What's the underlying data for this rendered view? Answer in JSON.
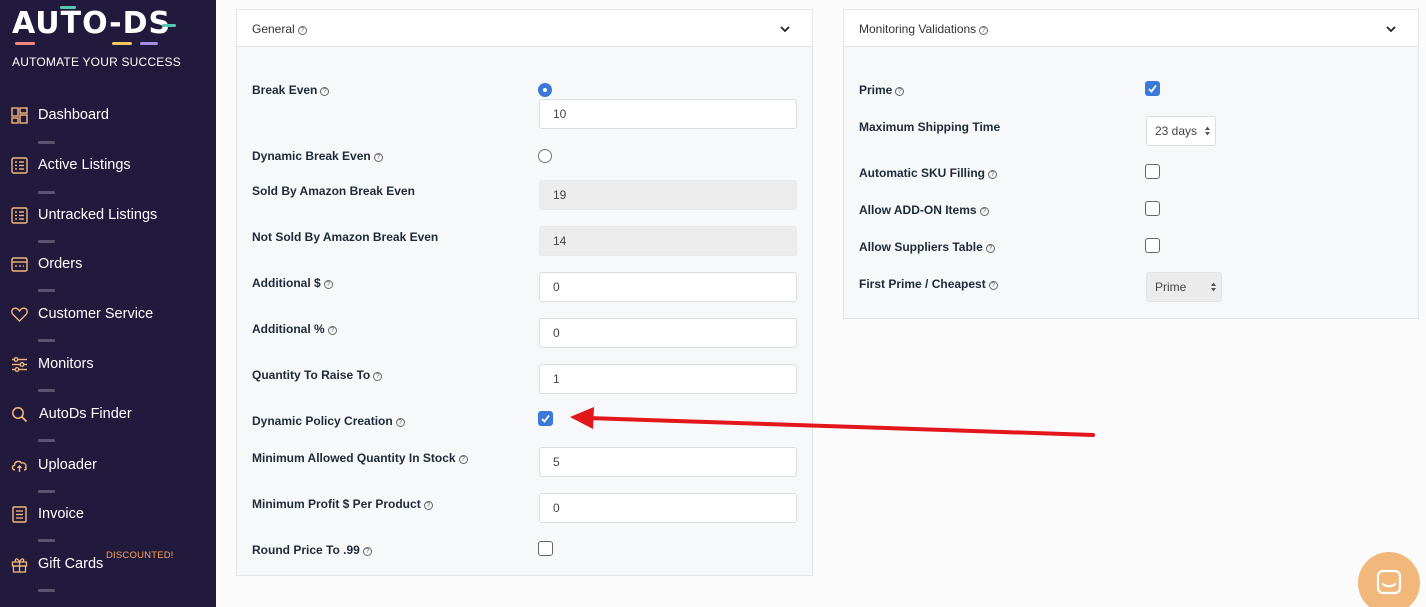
{
  "brand": {
    "logo_text": "AUTO-DS",
    "tagline": "AUTOMATE YOUR SUCCESS"
  },
  "sidebar": {
    "items": [
      {
        "label": "Dashboard",
        "icon": "dashboard-icon"
      },
      {
        "label": "Active Listings",
        "icon": "list-icon"
      },
      {
        "label": "Untracked Listings",
        "icon": "list-icon"
      },
      {
        "label": "Orders",
        "icon": "orders-icon"
      },
      {
        "label": "Customer Service",
        "icon": "heart-icon"
      },
      {
        "label": "Monitors",
        "icon": "sliders-icon"
      },
      {
        "label": "AutoDs Finder",
        "icon": "search-icon"
      },
      {
        "label": "Uploader",
        "icon": "cloud-upload-icon"
      },
      {
        "label": "Invoice",
        "icon": "invoice-icon"
      },
      {
        "label": "Gift Cards",
        "icon": "gift-icon",
        "badge": "DISCOUNTED!"
      }
    ]
  },
  "general": {
    "title": "General",
    "break_even": {
      "label": "Break Even",
      "selected": true,
      "value": "10"
    },
    "dynamic_break_even": {
      "label": "Dynamic Break Even",
      "selected": false
    },
    "sold_by_amazon": {
      "label": "Sold By Amazon Break Even",
      "value": "19"
    },
    "not_sold_by_amazon": {
      "label": "Not Sold By Amazon Break Even",
      "value": "14"
    },
    "additional_dollar": {
      "label": "Additional $",
      "value": "0"
    },
    "additional_percent": {
      "label": "Additional %",
      "value": "0"
    },
    "quantity_raise": {
      "label": "Quantity To Raise To",
      "value": "1"
    },
    "dynamic_policy": {
      "label": "Dynamic Policy Creation",
      "checked": true
    },
    "min_quantity": {
      "label": "Minimum Allowed Quantity In Stock",
      "value": "5"
    },
    "min_profit": {
      "label": "Minimum Profit $ Per Product",
      "value": "0"
    },
    "round_price": {
      "label": "Round Price To .99",
      "checked": false
    }
  },
  "monitoring": {
    "title": "Monitoring Validations",
    "prime": {
      "label": "Prime",
      "checked": true
    },
    "max_shipping": {
      "label": "Maximum Shipping Time",
      "value": "23 days"
    },
    "auto_sku": {
      "label": "Automatic SKU Filling",
      "checked": false
    },
    "allow_addon": {
      "label": "Allow ADD-ON Items",
      "checked": false
    },
    "allow_suppliers": {
      "label": "Allow Suppliers Table",
      "checked": false
    },
    "first_prime": {
      "label": "First Prime / Cheapest",
      "value": "Prime"
    }
  },
  "colors": {
    "sidebar_bg": "#221a3d",
    "accent_blue": "#3c78d8",
    "arrow_red": "#e3161b",
    "chat_button": "#f2b77a"
  }
}
